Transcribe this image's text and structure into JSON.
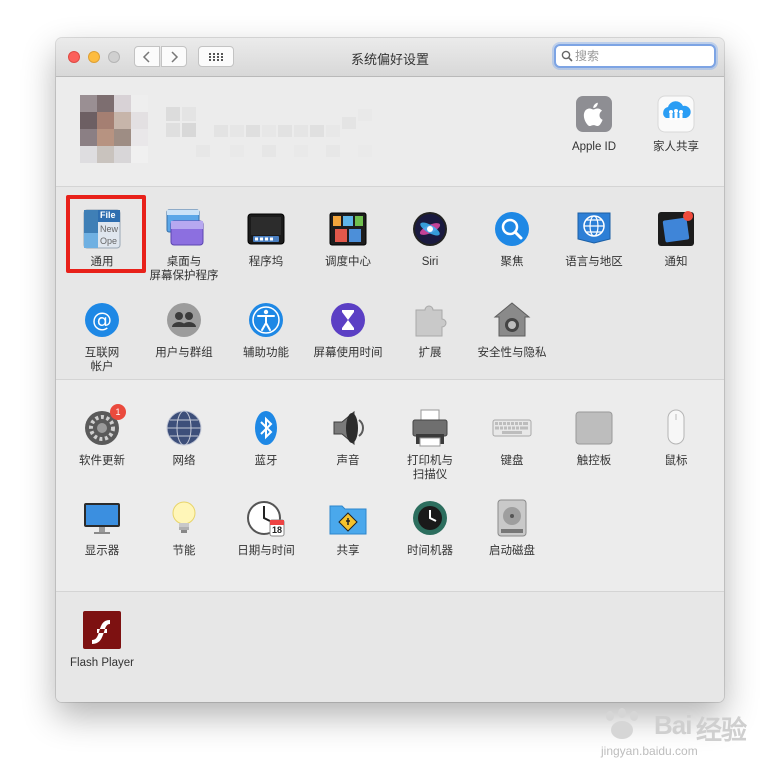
{
  "window": {
    "title": "系统偏好设置",
    "search_placeholder": "搜索"
  },
  "account": {
    "items": [
      {
        "label": "Apple ID",
        "icon": "apple-icon"
      },
      {
        "label": "家人共享",
        "icon": "family-sharing-icon"
      }
    ]
  },
  "row1": [
    {
      "label": "通用",
      "icon": "general-icon",
      "selected": true
    },
    {
      "label": "桌面与\n屏幕保护程序",
      "icon": "desktop-screensaver-icon"
    },
    {
      "label": "程序坞",
      "icon": "dock-icon"
    },
    {
      "label": "调度中心",
      "icon": "mission-control-icon"
    },
    {
      "label": "Siri",
      "icon": "siri-icon"
    },
    {
      "label": "聚焦",
      "icon": "spotlight-icon"
    },
    {
      "label": "语言与地区",
      "icon": "language-region-icon"
    },
    {
      "label": "通知",
      "icon": "notifications-icon"
    }
  ],
  "row2": [
    {
      "label": "互联网\n帐户",
      "icon": "internet-accounts-icon"
    },
    {
      "label": "用户与群组",
      "icon": "users-groups-icon"
    },
    {
      "label": "辅助功能",
      "icon": "accessibility-icon"
    },
    {
      "label": "屏幕使用时间",
      "icon": "screen-time-icon"
    },
    {
      "label": "扩展",
      "icon": "extensions-icon"
    },
    {
      "label": "安全性与隐私",
      "icon": "security-privacy-icon"
    }
  ],
  "row3": [
    {
      "label": "软件更新",
      "icon": "software-update-icon",
      "badge": "1"
    },
    {
      "label": "网络",
      "icon": "network-icon"
    },
    {
      "label": "蓝牙",
      "icon": "bluetooth-icon"
    },
    {
      "label": "声音",
      "icon": "sound-icon"
    },
    {
      "label": "打印机与\n扫描仪",
      "icon": "printers-scanners-icon"
    },
    {
      "label": "键盘",
      "icon": "keyboard-icon"
    },
    {
      "label": "触控板",
      "icon": "trackpad-icon"
    },
    {
      "label": "鼠标",
      "icon": "mouse-icon"
    }
  ],
  "row4": [
    {
      "label": "显示器",
      "icon": "displays-icon"
    },
    {
      "label": "节能",
      "icon": "energy-saver-icon"
    },
    {
      "label": "日期与时间",
      "icon": "date-time-icon",
      "date_number": "18",
      "date_month": "JUL"
    },
    {
      "label": "共享",
      "icon": "sharing-icon"
    },
    {
      "label": "时间机器",
      "icon": "time-machine-icon"
    },
    {
      "label": "启动磁盘",
      "icon": "startup-disk-icon"
    }
  ],
  "third_party": [
    {
      "label": "Flash Player",
      "icon": "flash-player-icon"
    }
  ],
  "general_icon_text": [
    "File",
    "New",
    "Ope"
  ],
  "watermark": {
    "brand": "Bai",
    "brand2": "经验",
    "url": "jingyan.baidu.com"
  },
  "colors": {
    "highlight": "#e8211a",
    "accent": "#1e88e5"
  }
}
